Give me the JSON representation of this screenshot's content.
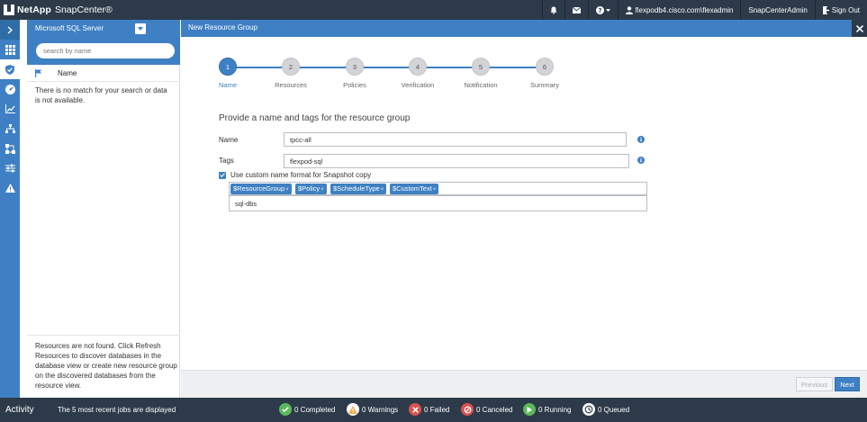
{
  "app": {
    "brand": "NetApp",
    "product": "SnapCenter®"
  },
  "topbar": {
    "user": "flexpodb4.cisco.com\\flexadmin",
    "role": "SnapCenterAdmin",
    "signout": "Sign Out"
  },
  "panel": {
    "selected": "Microsoft SQL Server",
    "search_placeholder": "search by name",
    "column_name": "Name",
    "empty_message": "There is no match for your search or data is not available.",
    "footer_message": "Resources are not found. Click Refresh Resources to discover databases in the database view or create new resource group on the discovered databases from the resource view."
  },
  "main": {
    "title": "New Resource Group",
    "steps": [
      {
        "num": "1",
        "label": "Name"
      },
      {
        "num": "2",
        "label": "Resources"
      },
      {
        "num": "3",
        "label": "Policies"
      },
      {
        "num": "4",
        "label": "Verification"
      },
      {
        "num": "5",
        "label": "Notification"
      },
      {
        "num": "6",
        "label": "Summary"
      }
    ],
    "form": {
      "heading": "Provide a name and tags for the resource group",
      "name_label": "Name",
      "name_value": "tpcc-all",
      "tags_label": "Tags",
      "tags_value": "flexpod-sql",
      "custom_format_label": "Use custom name format for Snapshot copy",
      "custom_format_checked": true,
      "format_tags": [
        "$ResourceGroup",
        "$Policy",
        "$ScheduleType",
        "$CustomText"
      ],
      "custom_text_value": "sql-dbs"
    },
    "buttons": {
      "previous": "Previous",
      "next": "Next"
    }
  },
  "activity": {
    "title": "Activity",
    "message": "The 5 most recent jobs are displayed",
    "stats": {
      "completed": "0 Completed",
      "warnings": "0 Warnings",
      "failed": "0 Failed",
      "canceled": "0 Canceled",
      "running": "0 Running",
      "queued": "0 Queued"
    }
  },
  "colors": {
    "accent": "#3e80c3",
    "dark_bar": "#2d3a4a",
    "success": "#5cb85c",
    "warning": "#f0ad4e",
    "danger": "#d9534f"
  }
}
